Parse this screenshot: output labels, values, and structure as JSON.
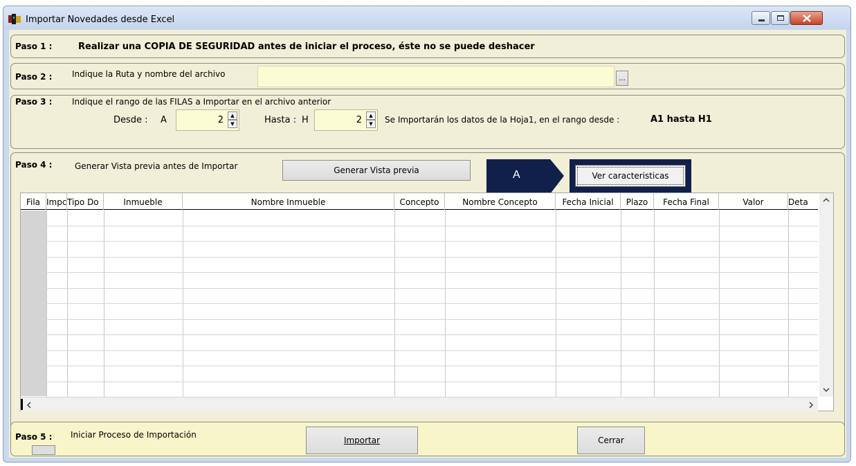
{
  "window": {
    "title": "Importar Novedades desde Excel",
    "controls": {
      "minimize": "minimize-icon",
      "maximize": "maximize-icon",
      "close": "close-icon"
    }
  },
  "step1": {
    "label": "Paso 1 :",
    "text": "Realizar una COPIA DE SEGURIDAD antes de iniciar el proceso, éste no se puede deshacer"
  },
  "step2": {
    "label": "Paso 2 :",
    "text": "Indique la Ruta y nombre del archivo",
    "path_value": "",
    "browse_label": "..."
  },
  "step3": {
    "label": "Paso 3 :",
    "text": "Indique el rango de las FILAS a Importar en el archivo anterior",
    "desde_label": "Desde :",
    "desde_col": "A",
    "desde_value": "2",
    "hasta_label": "Hasta :",
    "hasta_col": "H",
    "hasta_value": "2",
    "range_text": "Se Importarán los datos de la Hoja1,  en el rango desde :",
    "range_value": "A1 hasta H1"
  },
  "step4": {
    "label": "Paso 4 :",
    "text": "Generar Vista previa antes de Importar",
    "preview_button": "Generar Vista previa",
    "features_button": "Ver caracteristicas",
    "callout_label": "A",
    "columns": [
      "Fila",
      "Impc",
      "Tipo Do",
      "Inmueble",
      "Nombre Inmueble",
      "Concepto",
      "Nombre Concepto",
      "Fecha Inicial",
      "Plazo",
      "Fecha Final",
      "Valor",
      "Deta"
    ]
  },
  "step5": {
    "label": "Paso 5 :",
    "text": "Iniciar Proceso de Importación",
    "import_button": "Importar",
    "close_button": "Cerrar"
  },
  "colors": {
    "panel_bg": "#f1efd7",
    "input_bg": "#fbfbd4",
    "callout_bg": "#10204a"
  }
}
